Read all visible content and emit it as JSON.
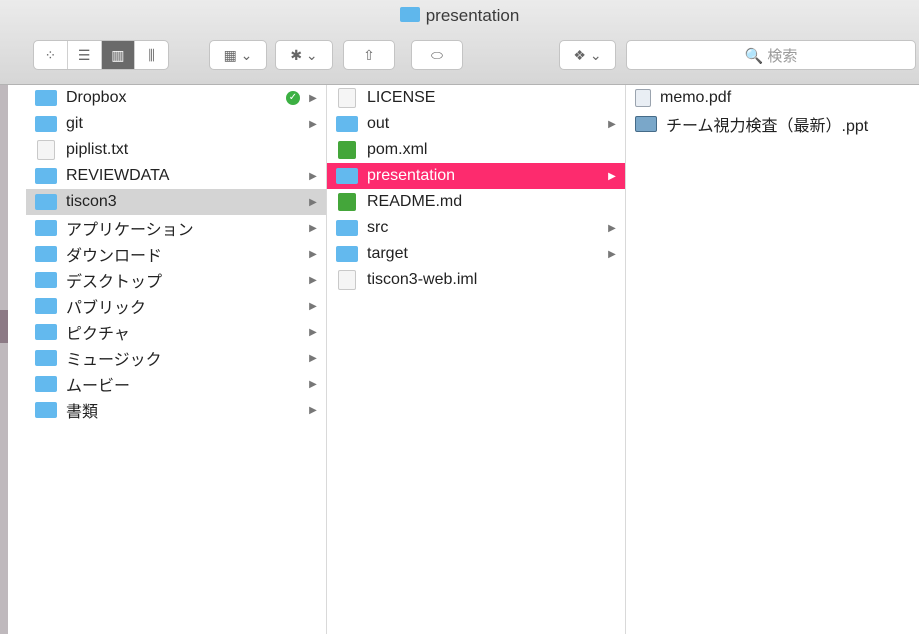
{
  "window": {
    "title": "presentation"
  },
  "toolbar": {
    "view_icons": [
      "icon-view-icon",
      "list-view-icon",
      "column-view-icon",
      "coverflow-view-icon"
    ],
    "arrange_glyph": "▦ ⌄",
    "action_glyph": "✱ ⌄",
    "share_glyph": "⇧",
    "tag_glyph": "⬭",
    "dropbox_glyph": "❖ ⌄",
    "search_placeholder": "🔍 検索"
  },
  "column1": [
    {
      "label": "Dropbox",
      "icon": "dropbox-folder-icon",
      "arrow": "▶",
      "check": "✓"
    },
    {
      "label": "git",
      "icon": "folder-icon",
      "arrow": "▶"
    },
    {
      "label": "piplist.txt",
      "icon": "text-file-icon",
      "arrow": ""
    },
    {
      "label": "REVIEWDATA",
      "icon": "folder-icon",
      "arrow": "▶"
    },
    {
      "label": "tiscon3",
      "icon": "folder-icon",
      "arrow": "▶",
      "selected": "gray"
    },
    {
      "label": "アプリケーション",
      "icon": "applications-folder-icon",
      "arrow": "▶"
    },
    {
      "label": "ダウンロード",
      "icon": "downloads-folder-icon",
      "arrow": "▶"
    },
    {
      "label": "デスクトップ",
      "icon": "desktop-folder-icon",
      "arrow": "▶"
    },
    {
      "label": "パブリック",
      "icon": "public-folder-icon",
      "arrow": "▶"
    },
    {
      "label": "ピクチャ",
      "icon": "pictures-folder-icon",
      "arrow": "▶"
    },
    {
      "label": "ミュージック",
      "icon": "music-folder-icon",
      "arrow": "▶"
    },
    {
      "label": "ムービー",
      "icon": "movies-folder-icon",
      "arrow": "▶"
    },
    {
      "label": "書類",
      "icon": "documents-folder-icon",
      "arrow": "▶"
    }
  ],
  "column2": [
    {
      "label": "LICENSE",
      "icon": "text-file-icon",
      "arrow": ""
    },
    {
      "label": "out",
      "icon": "folder-icon",
      "arrow": "▶"
    },
    {
      "label": "pom.xml",
      "icon": "xml-file-icon",
      "arrow": ""
    },
    {
      "label": "presentation",
      "icon": "folder-icon",
      "arrow": "▶",
      "selected": "pink"
    },
    {
      "label": "README.md",
      "icon": "markdown-file-icon",
      "arrow": ""
    },
    {
      "label": "src",
      "icon": "folder-icon",
      "arrow": "▶"
    },
    {
      "label": "target",
      "icon": "folder-icon",
      "arrow": "▶"
    },
    {
      "label": "tiscon3-web.iml",
      "icon": "text-file-icon",
      "arrow": ""
    }
  ],
  "column3": [
    {
      "label": "memo.pdf",
      "icon": "pdf-file-icon",
      "arrow": ""
    },
    {
      "label": "チーム視力検査（最新）.ppt",
      "icon": "ppt-file-icon",
      "arrow": ""
    }
  ],
  "colors": {
    "selection_pink": "#fd2b6e",
    "selection_gray": "#d4d4d4",
    "folder_blue": "#63b9ee"
  }
}
